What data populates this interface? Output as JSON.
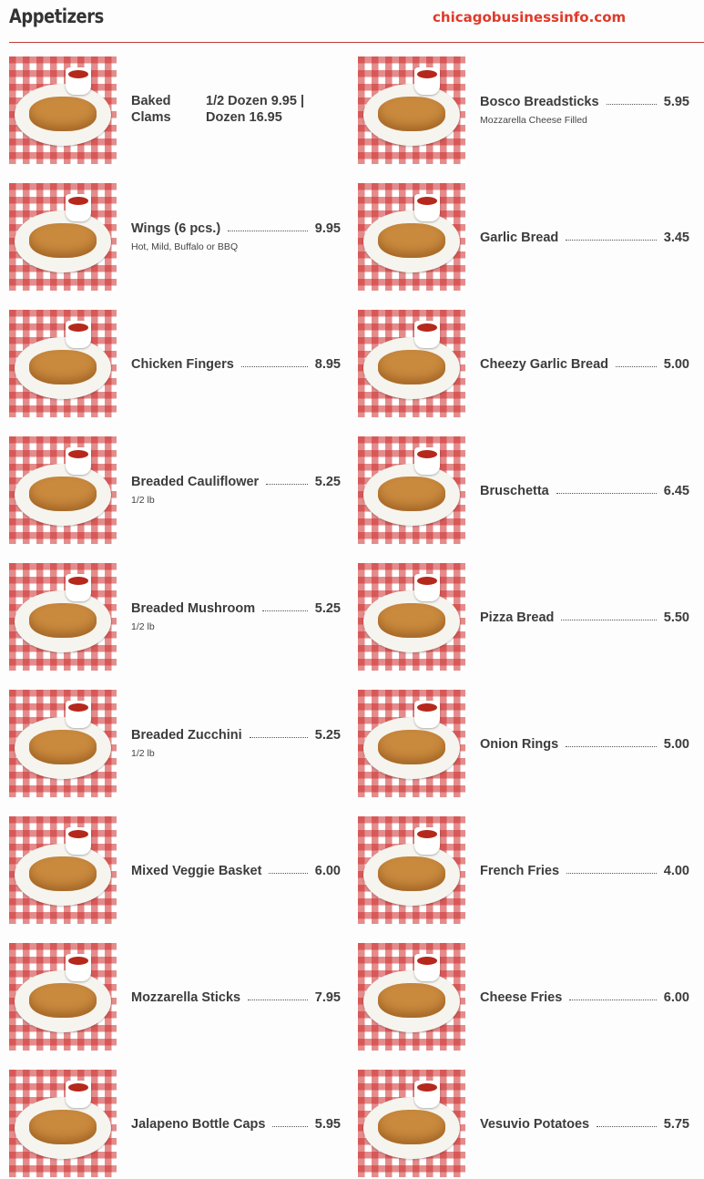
{
  "header": {
    "title": "Appetizers",
    "brand": "chicagobusinessinfo.com"
  },
  "left": [
    {
      "name": "Baked Clams",
      "name_lines": [
        "Baked",
        "Clams"
      ],
      "price_lines": [
        "1/2 Dozen 9.95 |",
        "Dozen 16.95"
      ],
      "desc": "",
      "image_icon": "baked-clams-photo"
    },
    {
      "name": "Wings (6 pcs.)",
      "price": "9.95",
      "desc": "Hot, Mild, Buffalo or BBQ",
      "image_icon": "wings-photo"
    },
    {
      "name": "Chicken Fingers",
      "price": "8.95",
      "desc": "",
      "image_icon": "chicken-fingers-photo"
    },
    {
      "name": "Breaded Cauliflower",
      "price": "5.25",
      "desc": "1/2 lb",
      "image_icon": "breaded-cauliflower-photo"
    },
    {
      "name": "Breaded Mushroom",
      "price": "5.25",
      "desc": "1/2 lb",
      "image_icon": "breaded-mushroom-photo"
    },
    {
      "name": "Breaded Zucchini",
      "price": "5.25",
      "desc": "1/2 lb",
      "image_icon": "breaded-zucchini-photo"
    },
    {
      "name": "Mixed Veggie Basket",
      "price": "6.00",
      "desc": "",
      "image_icon": "mixed-veggie-basket-photo"
    },
    {
      "name": "Mozzarella Sticks",
      "price": "7.95",
      "desc": "",
      "image_icon": "mozzarella-sticks-photo"
    },
    {
      "name": "Jalapeno Bottle Caps",
      "price": "5.95",
      "desc": "",
      "image_icon": "jalapeno-bottle-caps-photo"
    }
  ],
  "right": [
    {
      "name": "Bosco Breadsticks",
      "price": "5.95",
      "desc": "Mozzarella Cheese Filled",
      "image_icon": "bosco-breadsticks-photo"
    },
    {
      "name": "Garlic Bread",
      "price": "3.45",
      "desc": "",
      "image_icon": "garlic-bread-photo"
    },
    {
      "name": "Cheezy Garlic Bread",
      "price": "5.00",
      "desc": "",
      "image_icon": "cheezy-garlic-bread-photo"
    },
    {
      "name": "Bruschetta",
      "price": "6.45",
      "desc": "",
      "image_icon": "bruschetta-photo"
    },
    {
      "name": "Pizza Bread",
      "price": "5.50",
      "desc": "",
      "image_icon": "pizza-bread-photo"
    },
    {
      "name": "Onion Rings",
      "price": "5.00",
      "desc": "",
      "image_icon": "onion-rings-photo"
    },
    {
      "name": "French Fries",
      "price": "4.00",
      "desc": "",
      "image_icon": "french-fries-photo"
    },
    {
      "name": "Cheese Fries",
      "price": "6.00",
      "desc": "",
      "image_icon": "cheese-fries-photo"
    },
    {
      "name": "Vesuvio Potatoes",
      "price": "5.75",
      "desc": "",
      "image_icon": "vesuvio-potatoes-photo"
    }
  ],
  "colors": {
    "accent": "#e03a2a",
    "rule": "#c23a3a",
    "tablecloth": "#cd2d2d",
    "text": "#3c3c3c"
  }
}
